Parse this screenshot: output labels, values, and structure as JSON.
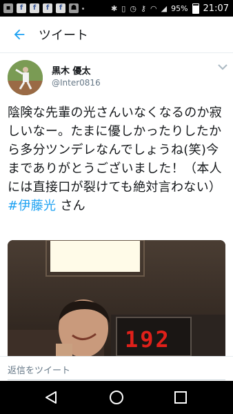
{
  "status_bar": {
    "battery_text": "95%",
    "time": "21:07",
    "app_icons": [
      "notification-icon",
      "facebook-icon",
      "facebook-icon",
      "facebook-icon",
      "facebook-icon",
      "android-icon",
      "dot-icon"
    ],
    "system_icons": [
      "bluetooth-icon",
      "vibrate-icon",
      "alarm-icon",
      "key-icon",
      "wifi-icon",
      "signal-icon",
      "battery-icon"
    ]
  },
  "app_bar": {
    "title": "ツイート",
    "back_icon": "back-arrow-icon"
  },
  "tweet": {
    "display_name": "黒木 優太",
    "handle": "@Inter0816",
    "text_before_tag": "陰険な先輩の光さんいなくなるのか寂しいなー。たまに優しかったりしたから多分ツンデレなんでしょうね(笑)今までありがとうございました！（本人には直接口が裂けても絶対言わない）",
    "hashtag": "#伊藤光",
    "text_after_tag": " さん",
    "menu_icon": "chevron-down-icon"
  },
  "media": {
    "scoreboard_value": "192"
  },
  "reply": {
    "placeholder": "返信をツイート"
  },
  "nav": {
    "back_icon": "nav-back-icon",
    "home_icon": "nav-home-icon",
    "recents_icon": "nav-recents-icon"
  },
  "colors": {
    "accent": "#1da1f2",
    "text": "#14171a",
    "secondary_text": "#657786",
    "scoreboard_digits": "#e0201a"
  }
}
